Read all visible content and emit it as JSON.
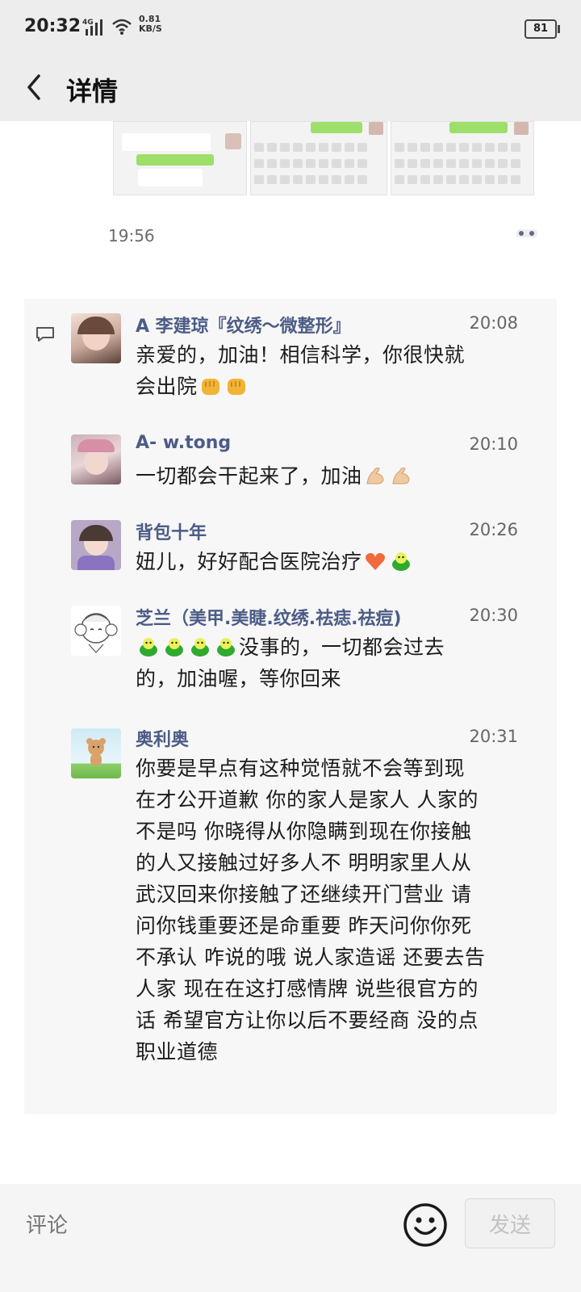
{
  "status_bar": {
    "time": "20:32",
    "network": "4G",
    "speed_value": "0.81",
    "speed_unit": "KB/S",
    "battery": "81"
  },
  "nav": {
    "title": "详情"
  },
  "post": {
    "time": "19:56"
  },
  "comments": [
    {
      "name": "A   李建琼『纹绣～微整形』",
      "time": "20:08",
      "lines": [
        "亲爱的，加油！相信科学，你很快就",
        "会出院"
      ],
      "trailing_emoji": [
        "fist",
        "fist"
      ]
    },
    {
      "name": "A- w.tong",
      "time": "20:10",
      "text": "一切都会干起来了，加油",
      "trailing_emoji": [
        "muscle",
        "muscle"
      ]
    },
    {
      "name": "背包十年",
      "time": "20:26",
      "text": "妞儿，好好配合医院治疗",
      "trailing_emoji": [
        "heart",
        "frog"
      ]
    },
    {
      "name": "芝兰（美甲.美睫.纹绣.祛痣.祛痘)",
      "time": "20:30",
      "leading_emoji": [
        "frog",
        "frog",
        "frog",
        "frog"
      ],
      "lines": [
        "没事的，一切都会过去",
        "的，加油喔，等你回来"
      ]
    },
    {
      "name": "奥利奥",
      "time": "20:31",
      "lines": [
        "你要是早点有这种觉悟就不会等到现",
        "在才公开道歉 你的家人是家人 人家的",
        "不是吗 你晓得从你隐瞒到现在你接触",
        "的人又接触过好多人不 明明家里人从",
        "武汉回来你接触了还继续开门营业 请",
        "问你钱重要还是命重要 昨天问你你死",
        "不承认 咋说的哦 说人家造谣 还要去告",
        "人家 现在在这打感情牌 说些很官方的",
        "话 希望官方让你以后不要经商 没的点",
        "职业道德"
      ]
    }
  ],
  "input": {
    "placeholder": "评论",
    "send_label": "发送"
  },
  "icons": {
    "back": "chevron-left-icon",
    "comment": "comment-icon",
    "more": "more-dots-icon",
    "emoji": "smile-icon"
  },
  "colors": {
    "name": "#4c5c86",
    "header_bg": "#ededed",
    "comment_bg": "#f7f7f7"
  }
}
